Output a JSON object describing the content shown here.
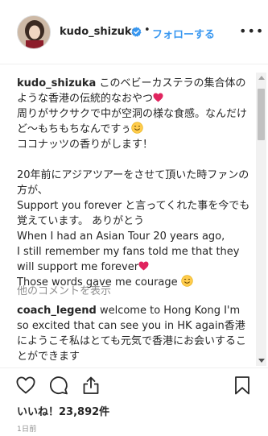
{
  "header": {
    "avatar_icon": "profile-avatar",
    "username": "kudo_shizuka",
    "verified_icon": "verified-badge-icon",
    "separator": "•",
    "follow_label": "フォローする",
    "more_icon": "ellipsis-icon"
  },
  "caption": {
    "username": "kudo_shizuka",
    "line1": "このベビーカステラの集合体のような香港の伝統的なおやつ",
    "line2": "周りがサクサクで中が空洞の様な食感。なんだけど〜もちもちなんですぅ",
    "line3": "ココナッツの香りがします！",
    "line4": "20年前にアジアツアーをさせて頂いた時ファンの方が、",
    "line5": "Support you forever と言ってくれた事を今でも覚えています。 ありがとう",
    "line6": "When I had an Asian Tour 20 years ago,",
    "line7": "I still remember my fans told me that they will support me forever",
    "line8": "Those words gave me courage",
    "emoji_heart": "red-heart-emoji",
    "emoji_smile": "smiling-face-emoji"
  },
  "view_more_comments": "他のコメントを表示",
  "comment": {
    "username": "coach_legend",
    "text": "welcome to Hong Kong I'm so excited that can see you in HK again香港にようこそ私はとても元気で香港にお会いすることができます"
  },
  "actions": {
    "like_icon": "heart-outline-icon",
    "comment_icon": "comment-bubble-icon",
    "share_icon": "share-icon",
    "save_icon": "bookmark-icon"
  },
  "likes_text": "いいね！23,892件",
  "timestamp": "1日前",
  "colors": {
    "link_blue": "#3897f0",
    "text": "#262626",
    "muted": "#8e8e8e",
    "heart_red": "#e0245e"
  }
}
